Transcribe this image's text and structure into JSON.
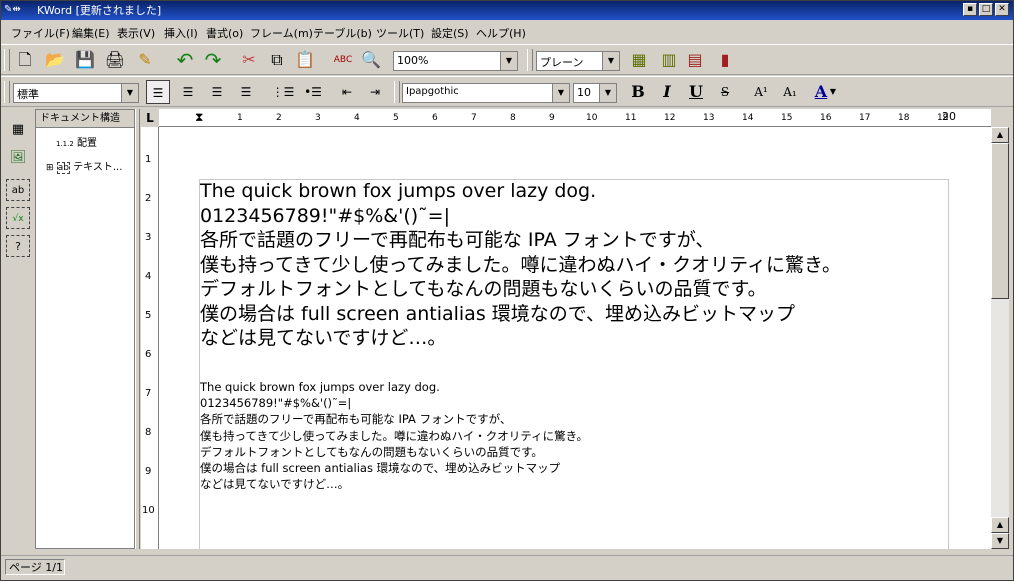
{
  "window": {
    "title": "KWord [更新されました]",
    "buttons": {
      "minimize": "▪",
      "maximize": "□",
      "close": "✕"
    }
  },
  "menu": [
    {
      "label": "ファイル(F)"
    },
    {
      "label": "編集(E)"
    },
    {
      "label": "表示(V)"
    },
    {
      "label": "挿入(I)"
    },
    {
      "label": "書式(o)"
    },
    {
      "label": "フレーム(m)"
    },
    {
      "label": "テーブル(b)"
    },
    {
      "label": "ツール(T)"
    },
    {
      "label": "設定(S)"
    },
    {
      "label": "ヘルプ(H)"
    }
  ],
  "toolbar1": {
    "zoom": "100%",
    "frame_style": "プレーン",
    "icons": {
      "new": "🗋",
      "open": "📂",
      "save": "💾",
      "print": "🖨",
      "preview": "✎",
      "undo": "↶",
      "redo": "↷",
      "cut": "✂",
      "copy": "⧉",
      "paste": "📋",
      "spell": "ABC",
      "find": "🔍",
      "table_a": "▦",
      "table_b": "▥",
      "table_c": "▤",
      "table_d": "▮"
    }
  },
  "toolbar2": {
    "style": "標準",
    "font": "Ipapgothic",
    "size": "10",
    "bold": "B",
    "italic": "I",
    "underline": "U",
    "strike": "S",
    "superscript": "A¹",
    "subscript": "A₁",
    "text_color": "A",
    "icons": {
      "align_left": "☰",
      "align_center": "☰",
      "align_right": "☰",
      "justify": "☰",
      "list_num": "⋮☰",
      "list_bullet": "•☰",
      "indent_dec": "⇤",
      "indent_inc": "⇥"
    }
  },
  "left_toolbar": {
    "icons": {
      "table": "▦",
      "picture": "🖼",
      "text": "ab",
      "formula": "√x",
      "variable": "?"
    }
  },
  "doc_structure": {
    "title": "ドキュメント構造",
    "items": [
      {
        "icon": "1.1.2",
        "label": "配置"
      },
      {
        "icon": "ab",
        "label": "テキスト..."
      }
    ]
  },
  "hruler_ticks": [
    "1",
    "2",
    "3",
    "4",
    "5",
    "6",
    "7",
    "8",
    "9",
    "10",
    "11",
    "12",
    "13",
    "14",
    "15",
    "16",
    "17",
    "18",
    "19",
    "20"
  ],
  "vruler_ticks": [
    "1",
    "2",
    "3",
    "4",
    "5",
    "6",
    "7",
    "8",
    "9",
    "10"
  ],
  "corner": "L",
  "document": {
    "large_lines": [
      "The quick brown fox jumps over lazy dog.",
      "0123456789!\"#$%&'()˜=|",
      "各所で話題のフリーで再配布も可能な IPA フォントですが、",
      "僕も持ってきて少し使ってみました。噂に違わぬハイ・クオリティに驚き。",
      "デフォルトフォントとしてもなんの問題もないくらいの品質です。",
      "僕の場合は full screen antialias 環境なので、埋め込みビットマップ",
      "などは見てないですけど…。"
    ],
    "small_lines": [
      "The quick brown fox jumps over lazy dog.",
      "0123456789!\"#$%&'()˜=|",
      "各所で話題のフリーで再配布も可能な IPA フォントですが、",
      "僕も持ってきて少し使ってみました。噂に違わぬハイ・クオリティに驚き。",
      "デフォルトフォントとしてもなんの問題もないくらいの品質です。",
      "僕の場合は full screen antialias 環境なので、埋め込みビットマップ",
      "などは見てないですけど…。"
    ]
  },
  "status": {
    "page": "ページ 1/1"
  }
}
